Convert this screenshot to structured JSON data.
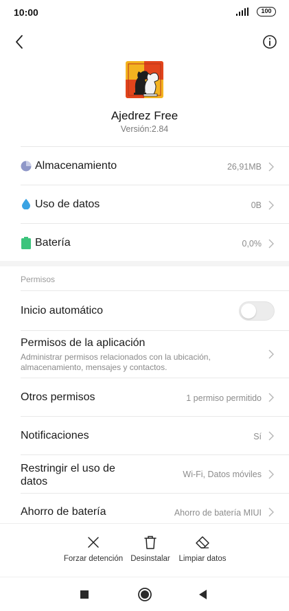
{
  "status_bar": {
    "time": "10:00",
    "battery": "100"
  },
  "app": {
    "name": "Ajedrez Free",
    "version": "Versión:2.84"
  },
  "info_rows": [
    {
      "label": "Almacenamiento",
      "value": "26,91MB",
      "icon": "storage-pie-icon",
      "icon_color": "#8f97c8"
    },
    {
      "label": "Uso de datos",
      "value": "0B",
      "icon": "data-drop-icon",
      "icon_color": "#3aa3e3"
    },
    {
      "label": "Batería",
      "value": "0,0%",
      "icon": "battery-icon",
      "icon_color": "#3cc47c"
    }
  ],
  "permissions": {
    "section_title": "Permisos",
    "autostart": {
      "label": "Inicio automático",
      "enabled": false
    },
    "app_permissions": {
      "label": "Permisos de la aplicación",
      "description": "Administrar permisos relacionados con la ubicación, almacenamiento, mensajes y contactos."
    },
    "other_permissions": {
      "label": "Otros permisos",
      "value": "1 permiso permitido"
    },
    "notifications": {
      "label": "Notificaciones",
      "value": "Sí"
    },
    "restrict_data": {
      "label": "Restringir el uso de datos",
      "value": "Wi-Fi, Datos móviles"
    },
    "battery_saver": {
      "label": "Ahorro de batería",
      "value": "Ahorro de batería MIUI"
    }
  },
  "actions": {
    "force_stop": "Forzar detención",
    "uninstall": "Desinstalar",
    "clear_data": "Limpiar datos"
  },
  "colors": {
    "toggle_off": "#ececec",
    "section_gap": "#f4f4f4"
  }
}
